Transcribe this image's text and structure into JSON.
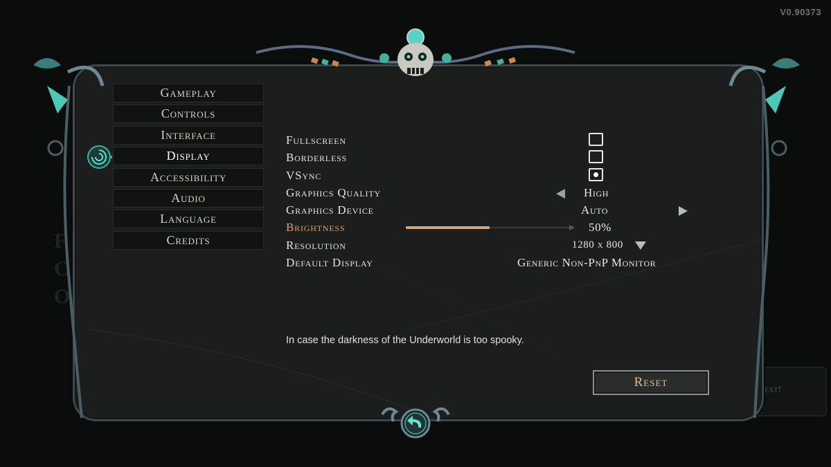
{
  "version": "V0.90373",
  "menu": {
    "items": [
      {
        "label": "Gameplay"
      },
      {
        "label": "Controls"
      },
      {
        "label": "Interface"
      },
      {
        "label": "Display"
      },
      {
        "label": "Accessibility"
      },
      {
        "label": "Audio"
      },
      {
        "label": "Language"
      },
      {
        "label": "Credits"
      }
    ],
    "active_index": 3
  },
  "settings": {
    "fullscreen": {
      "label": "Fullscreen",
      "checked": false
    },
    "borderless": {
      "label": "Borderless",
      "checked": false
    },
    "vsync": {
      "label": "VSync",
      "checked": true
    },
    "graphics_quality": {
      "label": "Graphics Quality",
      "value": "High"
    },
    "graphics_device": {
      "label": "Graphics Device",
      "value": "Auto"
    },
    "brightness": {
      "label": "Brightness",
      "value": "50%",
      "fraction": 0.5
    },
    "resolution": {
      "label": "Resolution",
      "value": "1280 x 800"
    },
    "default_display": {
      "label": "Default Display",
      "value": "Generic Non-PnP Monitor"
    }
  },
  "hint": "In case the darkness of the Underworld is too spooky.",
  "reset_label": "Reset",
  "background_next_label": "Next!",
  "colors": {
    "highlight": "#e0a065",
    "slider_fill": "#d2a675",
    "accent_teal": "#3fb39e",
    "reset_text": "#e6b98a"
  },
  "icons": [
    "skull-icon",
    "menu-marker-icon",
    "back-arrow-icon",
    "dropdown-arrow-icon",
    "left-arrow-icon",
    "right-arrow-icon"
  ]
}
